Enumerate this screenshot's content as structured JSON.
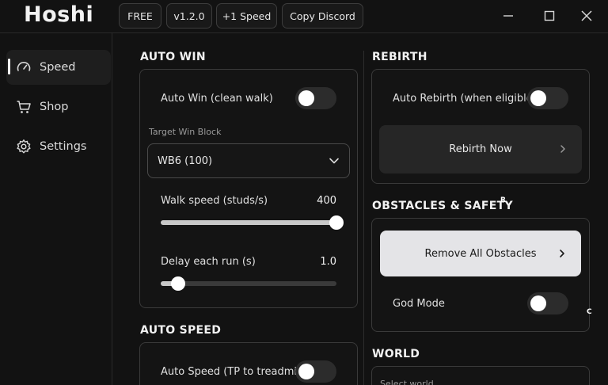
{
  "app": {
    "title": "Hoshi"
  },
  "toolbar": {
    "free_label": "FREE",
    "version_label": "v1.2.0",
    "speed_label": "+1 Speed",
    "discord_label": "Copy Discord"
  },
  "sidebar": {
    "items": [
      {
        "label": "Speed",
        "icon": "speedometer-icon",
        "active": true
      },
      {
        "label": "Shop",
        "icon": "cart-icon",
        "active": false
      },
      {
        "label": "Settings",
        "icon": "gear-icon",
        "active": false
      }
    ]
  },
  "auto_win": {
    "title": "AUTO WIN",
    "toggle_label": "Auto Win (clean walk)",
    "toggle_on": false,
    "target_label": "Target Win Block",
    "target_value": "WB6 (100)",
    "walk_label": "Walk speed (studs/s)",
    "walk_value": "400",
    "walk_fraction": 1.0,
    "delay_label": "Delay each run (s)",
    "delay_value": "1.0",
    "delay_fraction": 0.1
  },
  "auto_speed": {
    "title": "AUTO SPEED",
    "toggle_label": "Auto Speed (TP to treadmil",
    "toggle_on": false
  },
  "rebirth": {
    "title": "REBIRTH",
    "toggle_label": "Auto Rebirth (when eligible",
    "toggle_on": false,
    "button_label": "Rebirth Now"
  },
  "obstacles": {
    "title": "OBSTACLES & SAFETY",
    "button_label": "Remove All Obstacles",
    "god_label": "God Mode",
    "god_on": false
  },
  "world": {
    "title": "WORLD",
    "select_label": "Select world"
  },
  "markers": {
    "r": "R",
    "c": "C"
  },
  "colors": {
    "background": "#121212",
    "accent_light": "#e4e4e7",
    "toggle_off": "#2c2c2c"
  }
}
